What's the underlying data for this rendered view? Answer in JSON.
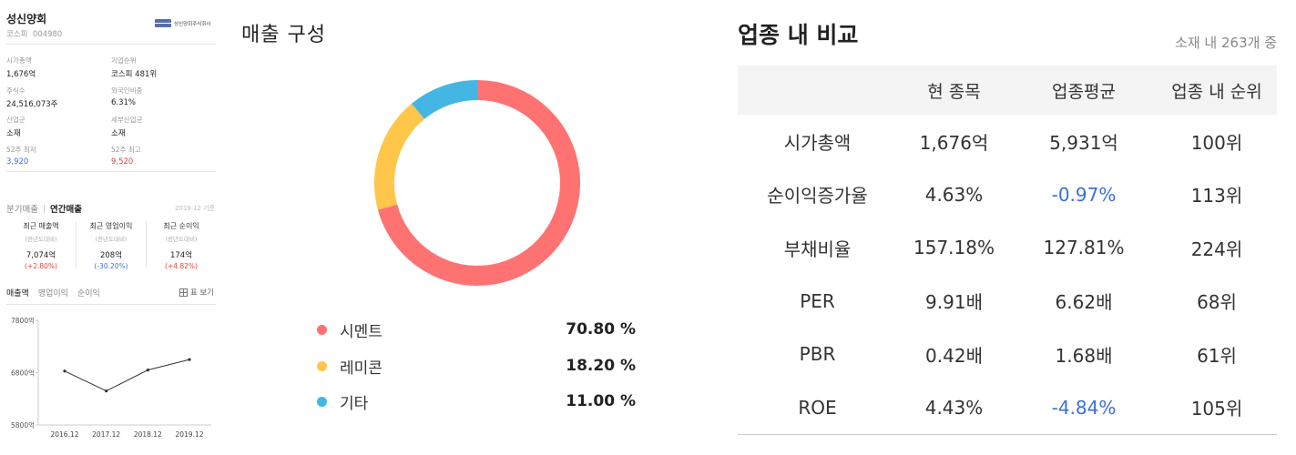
{
  "company": {
    "name": "성신양회",
    "market": "코스피",
    "code": "004980",
    "logo_text": "성신양회주식회사"
  },
  "summary": [
    {
      "label": "시가총액",
      "value": "1,676억"
    },
    {
      "label": "기업순위",
      "value": "코스피 481위"
    },
    {
      "label": "주식수",
      "value": "24,516,073주"
    },
    {
      "label": "외국인비중",
      "value": "6.31%"
    },
    {
      "label": "산업군",
      "value": "소재"
    },
    {
      "label": "세부산업군",
      "value": "소재"
    },
    {
      "label": "52주 최저",
      "value": "3,920"
    },
    {
      "label": "52주 최고",
      "value": "9,520"
    }
  ],
  "sales_tabs": {
    "quarter": "분기매출",
    "annual": "연간매출",
    "basis": "2019.12 기준"
  },
  "recent": [
    {
      "title": "최근 매출액",
      "sub": "(전년도대비)",
      "value": "7,074억",
      "delta": "(+2.80%)"
    },
    {
      "title": "최근 영업이익",
      "sub": "(전년도대비)",
      "value": "208억",
      "delta": "(-30.20%)"
    },
    {
      "title": "최근 순이익",
      "sub": "(전년도대비)",
      "value": "174억",
      "delta": "(+4.82%)"
    }
  ],
  "chart_tabs": [
    "매출액",
    "영업이익",
    "순이익"
  ],
  "table_view_label": "표 보기",
  "chart_data": {
    "type": "line",
    "categories": [
      "2016.12",
      "2017.12",
      "2018.12",
      "2019.12"
    ],
    "values": [
      6830,
      6450,
      6850,
      7050
    ],
    "yticks": [
      "7800억",
      "6800억",
      "5800억"
    ],
    "ylim": [
      5800,
      7800
    ],
    "grid": false
  },
  "composition": {
    "title": "매출 구성",
    "items": [
      {
        "name": "시멘트",
        "pct": "70.80 %",
        "value": 70.8,
        "color": "#ff7272"
      },
      {
        "name": "레미콘",
        "pct": "18.20 %",
        "value": 18.2,
        "color": "#ffc64a"
      },
      {
        "name": "기타",
        "pct": "11.00 %",
        "value": 11.0,
        "color": "#44b6e3"
      }
    ]
  },
  "comparison": {
    "title": "업종 내 비교",
    "subtitle": "소재 내 263개 중",
    "headers": [
      "",
      "현 종목",
      "업종평균",
      "업종 내 순위"
    ],
    "rows": [
      {
        "label": "시가총액",
        "stock": "1,676억",
        "avg": "5,931억",
        "rank": "100위",
        "avg_negative": false
      },
      {
        "label": "순이익증가율",
        "stock": "4.63%",
        "avg": "-0.97%",
        "rank": "113위",
        "avg_negative": true
      },
      {
        "label": "부채비율",
        "stock": "157.18%",
        "avg": "127.81%",
        "rank": "224위",
        "avg_negative": false
      },
      {
        "label": "PER",
        "stock": "9.91배",
        "avg": "6.62배",
        "rank": "68위",
        "avg_negative": false
      },
      {
        "label": "PBR",
        "stock": "0.42배",
        "avg": "1.68배",
        "rank": "61위",
        "avg_negative": false
      },
      {
        "label": "ROE",
        "stock": "4.43%",
        "avg": "-4.84%",
        "rank": "105위",
        "avg_negative": true
      }
    ]
  }
}
